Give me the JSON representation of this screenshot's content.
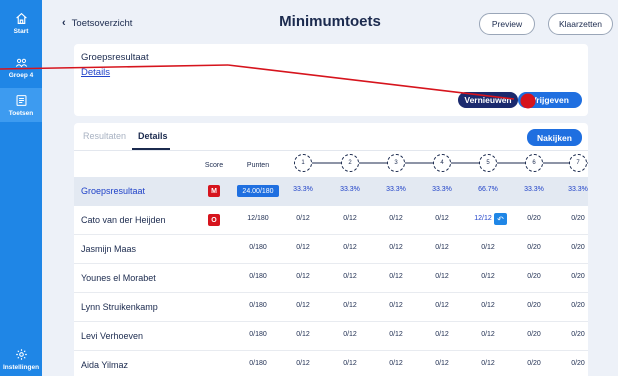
{
  "sidebar": {
    "items": [
      {
        "label": "Start",
        "icon": "home-icon"
      },
      {
        "label": "Groep 4",
        "icon": "group-icon"
      },
      {
        "label": "Toetsen",
        "icon": "test-icon"
      },
      {
        "label": "Instellingen",
        "icon": "gear-icon"
      }
    ]
  },
  "header": {
    "back_label": "Toetsoverzicht",
    "title": "Minimumtoets",
    "preview_label": "Preview",
    "klaarzetten_label": "Klaarzetten"
  },
  "summary_card": {
    "title": "Groepsresultaat",
    "details_link": "Details",
    "vernieuwen_label": "Vernieuwen",
    "vrijgeven_label": "Vrijgeven"
  },
  "results": {
    "tabs": [
      "Resultaten",
      "Details"
    ],
    "active_tab": "Details",
    "nakijken_label": "Nakijken",
    "columns": {
      "score": "Score",
      "punten": "Punten"
    },
    "questions": [
      "1",
      "2",
      "3",
      "4",
      "5",
      "6",
      "7"
    ],
    "rows": [
      {
        "name": "Groepsresultaat",
        "badge": "M",
        "punten": "24.00/180",
        "q": [
          "33.3%",
          "33.3%",
          "33.3%",
          "33.3%",
          "66.7%",
          "33.3%",
          "33.3%"
        ]
      },
      {
        "name": "Cato van der Heijden",
        "badge": "O",
        "punten": "12/180",
        "q": [
          "0/12",
          "0/12",
          "0/12",
          "0/12",
          "12/12",
          "0/20",
          "0/20"
        ]
      },
      {
        "name": "Jasmijn Maas",
        "badge": "",
        "punten": "0/180",
        "q": [
          "0/12",
          "0/12",
          "0/12",
          "0/12",
          "0/12",
          "0/20",
          "0/20"
        ]
      },
      {
        "name": "Younes el Morabet",
        "badge": "",
        "punten": "0/180",
        "q": [
          "0/12",
          "0/12",
          "0/12",
          "0/12",
          "0/12",
          "0/20",
          "0/20"
        ]
      },
      {
        "name": "Lynn Struikenkamp",
        "badge": "",
        "punten": "0/180",
        "q": [
          "0/12",
          "0/12",
          "0/12",
          "0/12",
          "0/12",
          "0/20",
          "0/20"
        ]
      },
      {
        "name": "Levi Verhoeven",
        "badge": "",
        "punten": "0/180",
        "q": [
          "0/12",
          "0/12",
          "0/12",
          "0/12",
          "0/12",
          "0/20",
          "0/20"
        ]
      },
      {
        "name": "Aida Yilmaz",
        "badge": "",
        "punten": "0/180",
        "q": [
          "0/12",
          "0/12",
          "0/12",
          "0/12",
          "0/12",
          "0/20",
          "0/20"
        ]
      }
    ]
  },
  "colors": {
    "sidebar": "#1f86e6",
    "navy": "#1b2a4e",
    "link_blue": "#2042c8",
    "badge_red": "#d6141d",
    "annotation_red": "#d6141d"
  }
}
